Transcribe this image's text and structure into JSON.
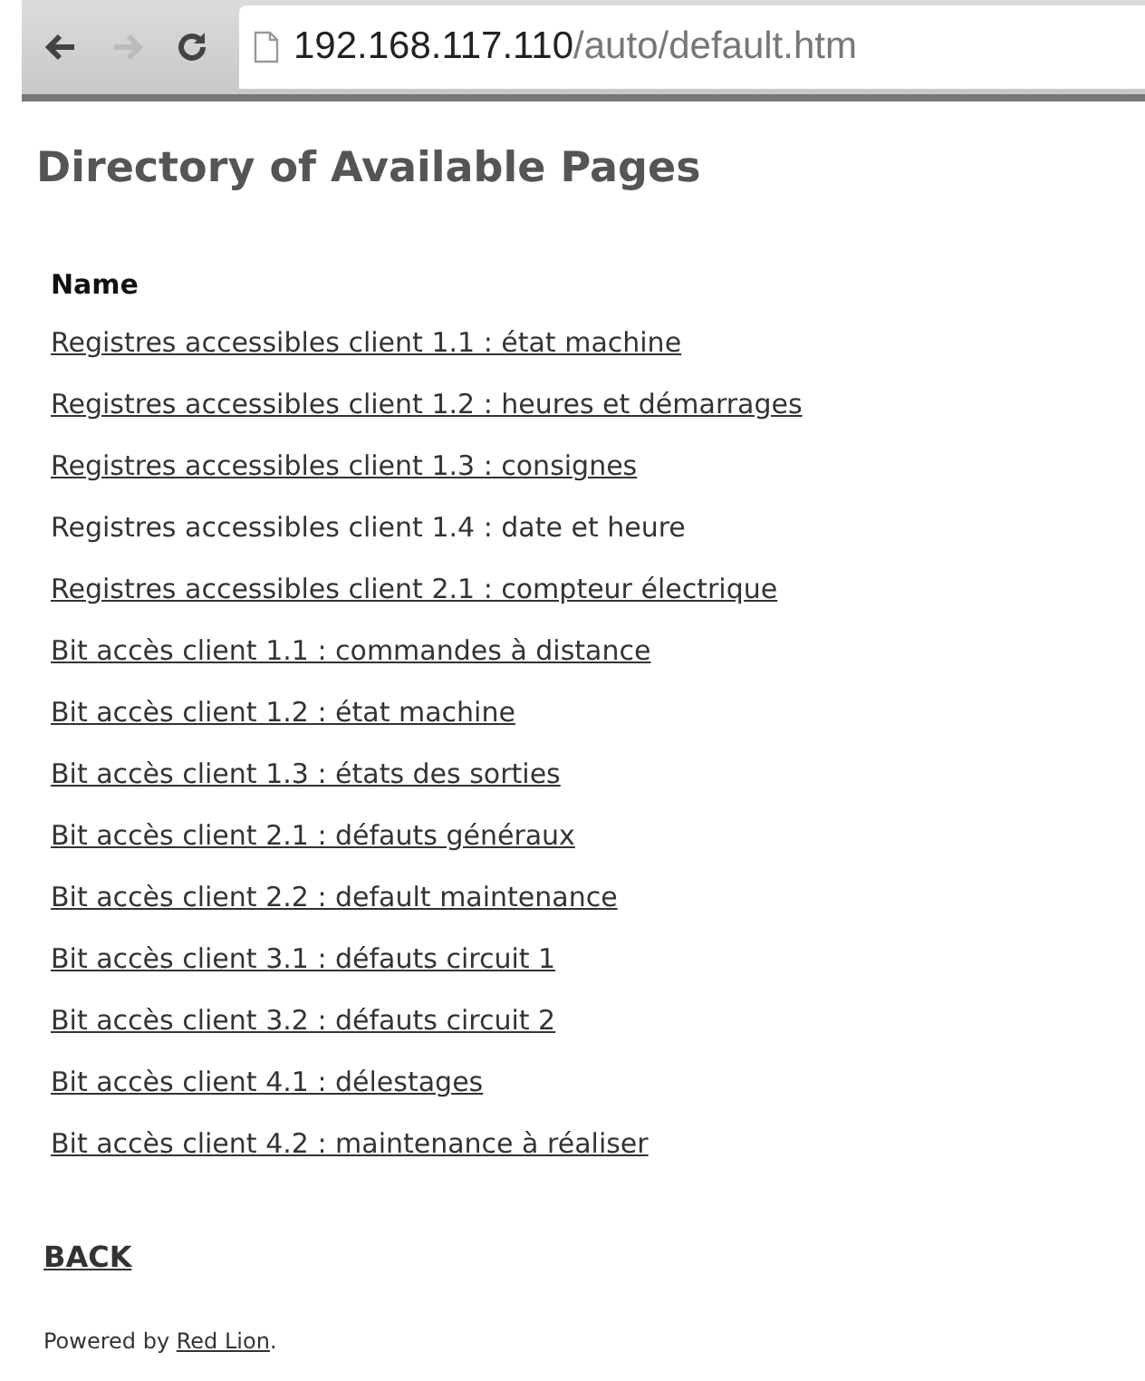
{
  "browser": {
    "url_host": "192.168.117.110",
    "url_path": "/auto/default.htm"
  },
  "title": "Directory of Available Pages",
  "table": {
    "column": "Name",
    "rows": [
      {
        "label": "Registres accessibles client 1.1 : état machine",
        "underlined": true
      },
      {
        "label": "Registres accessibles client 1.2 : heures et démarrages",
        "underlined": true
      },
      {
        "label": "Registres accessibles client 1.3 : consignes",
        "underlined": true
      },
      {
        "label": "Registres accessibles client 1.4 : date et heure",
        "underlined": false
      },
      {
        "label": "Registres accessibles client 2.1 : compteur électrique",
        "underlined": true
      },
      {
        "label": "Bit accès client 1.1 : commandes à distance",
        "underlined": true
      },
      {
        "label": "Bit accès client 1.2 : état machine",
        "underlined": true
      },
      {
        "label": "Bit accès client 1.3 : états des sorties",
        "underlined": true
      },
      {
        "label": "Bit accès client 2.1 : défauts généraux",
        "underlined": true
      },
      {
        "label": "Bit accès client 2.2 : default maintenance",
        "underlined": true
      },
      {
        "label": "Bit accès client 3.1 : défauts circuit 1",
        "underlined": true
      },
      {
        "label": "Bit accès client 3.2 : défauts circuit 2",
        "underlined": true
      },
      {
        "label": "Bit accès client 4.1 : délestages",
        "underlined": true
      },
      {
        "label": "Bit accès client 4.2 : maintenance à réaliser",
        "underlined": true
      }
    ]
  },
  "back": "BACK",
  "footer": {
    "before": "Powered by ",
    "link": "Red Lion",
    "after": "."
  }
}
